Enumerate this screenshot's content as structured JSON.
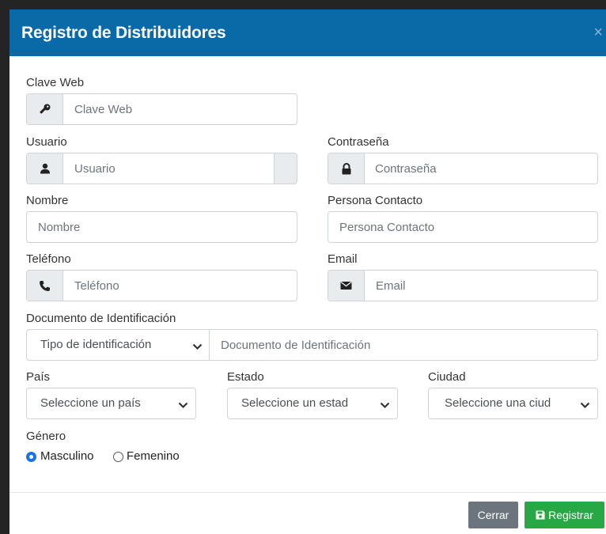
{
  "modal": {
    "title": "Registro de Distribuidores",
    "close_symbol": "×"
  },
  "fields": {
    "clave_web": {
      "label": "Clave Web",
      "placeholder": "Clave Web",
      "icon": "key-icon"
    },
    "usuario": {
      "label": "Usuario",
      "placeholder": "Usuario",
      "icon": "user-icon"
    },
    "contrasena": {
      "label": "Contraseña",
      "placeholder": "Contraseña",
      "icon": "lock-icon"
    },
    "nombre": {
      "label": "Nombre",
      "placeholder": "Nombre"
    },
    "persona_contacto": {
      "label": "Persona Contacto",
      "placeholder": "Persona Contacto"
    },
    "telefono": {
      "label": "Teléfono",
      "placeholder": "Teléfono",
      "icon": "phone-icon"
    },
    "email": {
      "label": "Email",
      "placeholder": "Email",
      "icon": "envelope-icon"
    },
    "documento": {
      "label": "Documento de Identificación",
      "tipo_selected": "Tipo de identificación",
      "placeholder": "Documento de Identificación"
    },
    "pais": {
      "label": "País",
      "selected": "Seleccione un país"
    },
    "estado": {
      "label": "Estado",
      "selected": "Seleccione un estad"
    },
    "ciudad": {
      "label": "Ciudad",
      "selected": "Seleccione una ciud"
    },
    "genero": {
      "label": "Género",
      "options": [
        {
          "label": "Masculino",
          "checked": true
        },
        {
          "label": "Femenino",
          "checked": false
        }
      ]
    }
  },
  "footer": {
    "close_label": "Cerrar",
    "register_label": "Registrar",
    "register_icon": "save-icon"
  },
  "colors": {
    "header": "#0a6aa8",
    "close_button": "#6c757d",
    "register_button": "#28a745",
    "radio_checked": "#1a73e8"
  }
}
